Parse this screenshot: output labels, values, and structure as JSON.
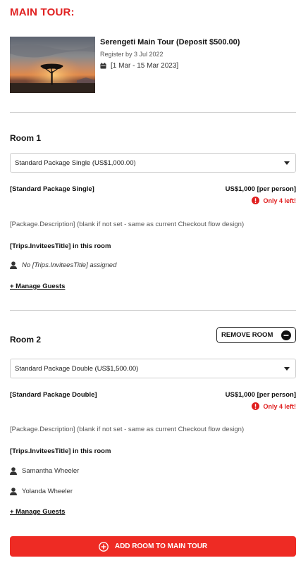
{
  "section_title": "MAIN TOUR:",
  "tour": {
    "name": "Serengeti Main Tour (Deposit $500.00)",
    "register_by": "Register by 3 Jul 2022",
    "dates": "[1 Mar - 15 Mar 2023]"
  },
  "rooms": [
    {
      "title": "Room 1",
      "select_value": "Standard Package Single (US$1,000.00)",
      "package_name": "[Standard Package Single]",
      "price": "US$1,000 [per person]",
      "availability": "Only 4 left!",
      "description": "[Package.Description] (blank if not set - same as current Checkout flow design)",
      "invitees_title": "[Trips.InviteesTitle] in this room",
      "guests": [
        "No [Trips.InviteesTitle] assigned"
      ],
      "manage_label": "+ Manage Guests"
    },
    {
      "title": "Room 2",
      "remove_label": "REMOVE ROOM",
      "select_value": "Standard Package Double (US$1,500.00)",
      "package_name": "[Standard Package Double]",
      "price": "US$1,000 [per person]",
      "availability": "Only 4 left!",
      "description": "[Package.Description] (blank if not set - same as current Checkout flow design)",
      "invitees_title": "[Trips.InviteesTitle] in this room",
      "guests": [
        "Samantha Wheeler",
        "Yolanda Wheeler"
      ],
      "manage_label": "+ Manage Guests"
    }
  ],
  "add_room_label": "ADD ROOM TO MAIN TOUR",
  "colors": {
    "accent": "#e02020",
    "button": "#ee2b24"
  },
  "icons": {
    "calendar": "calendar-icon",
    "alert": "alert-icon",
    "person": "person-icon",
    "minus": "minus-circle-icon",
    "plus": "plus-circle-icon"
  }
}
